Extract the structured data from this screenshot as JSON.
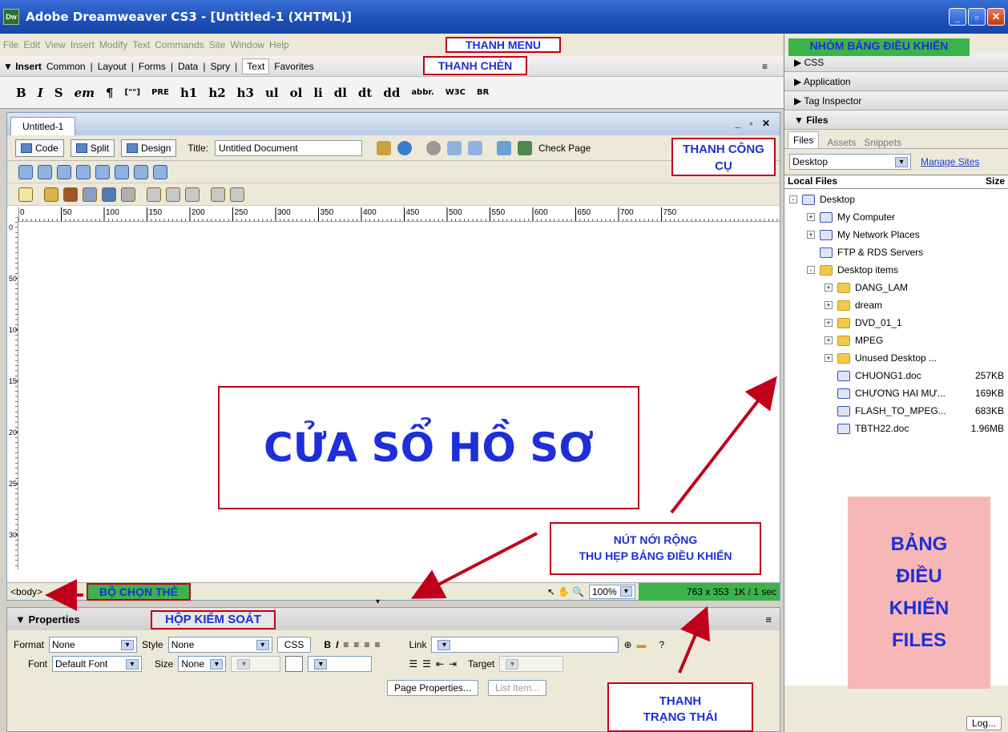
{
  "window": {
    "title": "Adobe Dreamweaver CS3 - [Untitled-1 (XHTML)]",
    "app_icon": "Dw"
  },
  "menu": [
    "File",
    "Edit",
    "View",
    "Insert",
    "Modify",
    "Text",
    "Commands",
    "Site",
    "Window",
    "Help"
  ],
  "insert_bar": {
    "label": "▼ Insert",
    "tabs": [
      "Common",
      "Layout",
      "Forms",
      "Data",
      "Spry",
      "Text",
      "Favorites"
    ],
    "active_tab": "Text"
  },
  "insert_buttons": [
    "B",
    "I",
    "S",
    "em",
    "¶",
    "[\"\"]",
    "PRE",
    "h1",
    "h2",
    "h3",
    "ul",
    "ol",
    "li",
    "dl",
    "dt",
    "dd",
    "abbr.",
    "W3C",
    "BR"
  ],
  "document": {
    "tab": "Untitled-1",
    "views": {
      "code": "Code",
      "split": "Split",
      "design": "Design"
    },
    "title_label": "Title:",
    "title_value": "Untitled Document",
    "check_page": "Check Page",
    "ruler_ticks": [
      "0",
      "50",
      "100",
      "150",
      "200",
      "250",
      "300",
      "350",
      "400",
      "450",
      "500",
      "550",
      "600",
      "650",
      "700",
      "750"
    ],
    "vruler_ticks": [
      "0",
      "50",
      "100",
      "150",
      "200",
      "250",
      "300"
    ]
  },
  "status": {
    "tag": "<body>",
    "zoom": "100%",
    "size": "763 x 353",
    "download": "1K / 1 sec"
  },
  "properties": {
    "header": "▼ Properties",
    "format_label": "Format",
    "format_value": "None",
    "style_label": "Style",
    "style_value": "None",
    "css_button": "CSS",
    "link_label": "Link",
    "font_label": "Font",
    "font_value": "Default Font",
    "size_label": "Size",
    "size_value": "None",
    "target_label": "Target",
    "page_properties": "Page Properties...",
    "list_item": "List Item..."
  },
  "panels": {
    "css": "▶ CSS",
    "application": "▶ Application",
    "tag_inspector": "▶ Tag Inspector",
    "files": "▼ Files",
    "files_tabs": [
      "Files",
      "Assets",
      "Snippets"
    ],
    "site": "Desktop",
    "manage_sites": "Manage Sites",
    "local_files": "Local Files",
    "size_col": "Size",
    "log": "Log..."
  },
  "tree": [
    {
      "name": "Desktop",
      "level": 0,
      "type": "root",
      "toggle": "-"
    },
    {
      "name": "My Computer",
      "level": 1,
      "type": "computer",
      "toggle": "+"
    },
    {
      "name": "My Network Places",
      "level": 1,
      "type": "network",
      "toggle": "+"
    },
    {
      "name": "FTP & RDS Servers",
      "level": 1,
      "type": "server",
      "toggle": ""
    },
    {
      "name": "Desktop items",
      "level": 1,
      "type": "folder",
      "toggle": "-"
    },
    {
      "name": "DANG_LAM",
      "level": 2,
      "type": "folder",
      "toggle": "+"
    },
    {
      "name": "dream",
      "level": 2,
      "type": "folder",
      "toggle": "+"
    },
    {
      "name": "DVD_01_1",
      "level": 2,
      "type": "folder",
      "toggle": "+"
    },
    {
      "name": "MPEG",
      "level": 2,
      "type": "folder",
      "toggle": "+"
    },
    {
      "name": "Unused Desktop ...",
      "level": 2,
      "type": "folder",
      "toggle": "+"
    },
    {
      "name": "CHUONG1.doc",
      "level": 2,
      "type": "doc",
      "toggle": "",
      "size": "257KB"
    },
    {
      "name": "CHƯƠNG HAI MƯ...",
      "level": 2,
      "type": "doc",
      "toggle": "",
      "size": "169KB"
    },
    {
      "name": "FLASH_TO_MPEG...",
      "level": 2,
      "type": "doc",
      "toggle": "",
      "size": "683KB"
    },
    {
      "name": "TBTH22.doc",
      "level": 2,
      "type": "doc",
      "toggle": "",
      "size": "1.96MB"
    }
  ],
  "annotations": {
    "menu": "THANH MENU",
    "insert": "THANH CHÈN",
    "panel_group": "NHÓM BẢNG ĐIỀU KHIỂN",
    "toolbar": "THANH CÔNG CỤ",
    "document_window": "CỬA SỔ HỒ SƠ",
    "expand_button_1": "NÚT NỚI RỘNG",
    "expand_button_2": "THU HẸP BẢNG ĐIỀU KHIỂN",
    "tag_selector": "BỘ CHỌN THẺ",
    "inspector": "HỘP KIỂM SOÁT",
    "status_1": "THANH",
    "status_2": "TRẠNG THÁI",
    "files_panel": [
      "BẢNG",
      "ĐIỀU",
      "KHIỂN",
      "FILES"
    ]
  }
}
